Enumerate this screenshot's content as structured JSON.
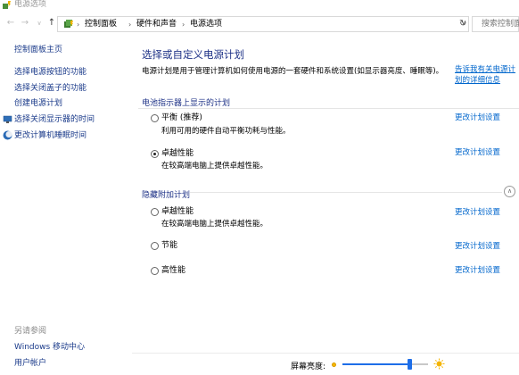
{
  "window": {
    "title": "电源选项"
  },
  "nav": {
    "breadcrumbs": [
      "控制面板",
      "硬件和声音",
      "电源选项"
    ],
    "search_placeholder": "搜索控制面板"
  },
  "sidebar": {
    "home": "控制面板主页",
    "links": [
      "选择电源按钮的功能",
      "选择关闭盖子的功能",
      "创建电源计划",
      "选择关闭显示器的时间",
      "更改计算机睡眠时间"
    ],
    "see_also": "另请参阅",
    "bottom_links": [
      "Windows 移动中心",
      "用户帐户"
    ]
  },
  "main": {
    "title": "选择或自定义电源计划",
    "description": "电源计划是用于管理计算机如何使用电源的一套硬件和系统设置(如显示器亮度、睡眠等)。",
    "description_link": "告诉我有关电源计划的详细信息",
    "battery_section": "电池指示器上显示的计划",
    "hidden_section": "隐藏附加计划",
    "change_link": "更改计划设置",
    "plans_battery": [
      {
        "name": "平衡 (推荐)",
        "desc": "利用可用的硬件自动平衡功耗与性能。",
        "selected": false
      },
      {
        "name": "卓越性能",
        "desc": "在较高端电脑上提供卓越性能。",
        "selected": true
      }
    ],
    "plans_hidden": [
      {
        "name": "卓越性能",
        "desc": "在较高端电脑上提供卓越性能。",
        "selected": false
      },
      {
        "name": "节能",
        "desc": "",
        "selected": false
      },
      {
        "name": "高性能",
        "desc": "",
        "selected": false
      }
    ]
  },
  "status": {
    "brightness_label": "屏幕亮度:",
    "brightness_value": 0.78
  }
}
